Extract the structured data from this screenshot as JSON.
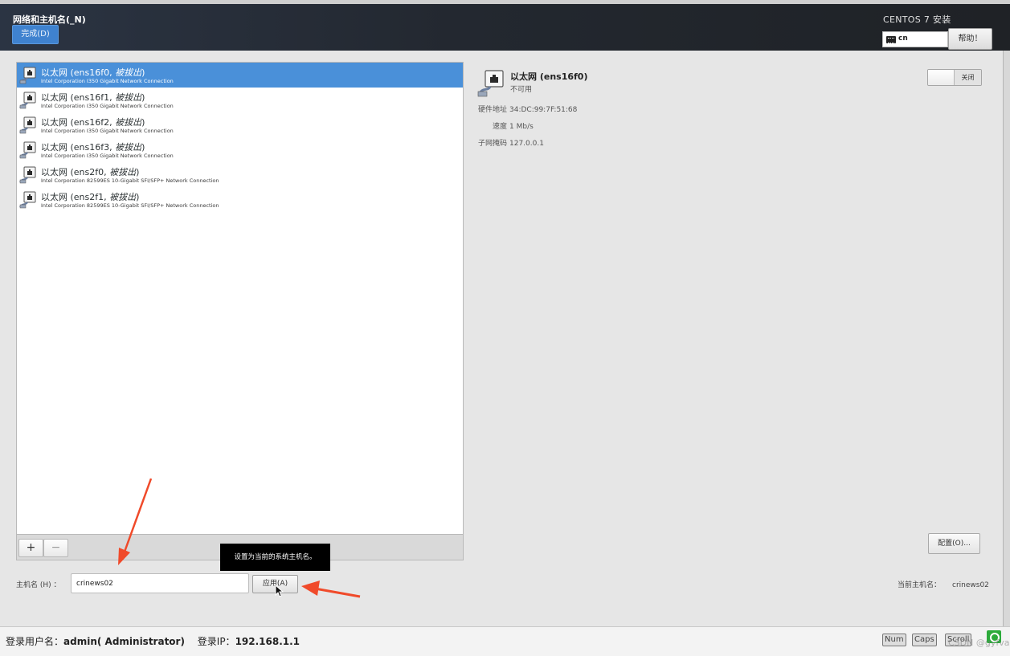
{
  "header": {
    "spoke_title": "网络和主机名(_N)",
    "done_label": "完成(D)",
    "product_title": "CENTOS 7 安装",
    "keyboard_layout": "cn",
    "help_label": "帮助！"
  },
  "devices": [
    {
      "name": "以太网 (ens16f0, ",
      "state": "被拔出",
      "close": ")",
      "description": "Intel Corporation I350 Gigabit Network Connection",
      "selected": true
    },
    {
      "name": "以太网 (ens16f1, ",
      "state": "被拔出",
      "close": ")",
      "description": "Intel Corporation I350 Gigabit Network Connection",
      "selected": false
    },
    {
      "name": "以太网 (ens16f2, ",
      "state": "被拔出",
      "close": ")",
      "description": "Intel Corporation I350 Gigabit Network Connection",
      "selected": false
    },
    {
      "name": "以太网 (ens16f3, ",
      "state": "被拔出",
      "close": ")",
      "description": "Intel Corporation I350 Gigabit Network Connection",
      "selected": false
    },
    {
      "name": "以太网 (ens2f0, ",
      "state": "被拔出",
      "close": ")",
      "description": "Intel Corporation 82599ES 10-Gigabit SFI/SFP+ Network Connection",
      "selected": false
    },
    {
      "name": "以太网 (ens2f1, ",
      "state": "被拔出",
      "close": ")",
      "description": "Intel Corporation 82599ES 10-Gigabit SFI/SFP+ Network Connection",
      "selected": false
    }
  ],
  "list_toolbar": {
    "add_label": "+",
    "remove_label": "−"
  },
  "detail": {
    "title": "以太网 (ens16f0)",
    "status": "不可用",
    "hw_label": "硬件地址",
    "hw_value": "34:DC:99:7F:51:68",
    "speed_label": "速度",
    "speed_value": "1 Mb/s",
    "mask_label": "子网掩码",
    "mask_value": "127.0.0.1",
    "toggle_label": "关闭",
    "config_label": "配置(O)..."
  },
  "hostname": {
    "label": "主机名 (H) ：",
    "value": "crinews02",
    "apply_label": "应用(A)",
    "tooltip": "设置为当前的系统主机名。",
    "current_label": "当前主机名：",
    "current_value": "crinews02"
  },
  "statusbar": {
    "user_label": "登录用户名：",
    "user_value": "admin( Administrator)",
    "ip_label": "登录IP：",
    "ip_value": "192.168.1.1",
    "num_lock": "Num",
    "caps_lock": "Caps",
    "scroll_lock": "Scroll",
    "watermark": "CSDN @gyfvar"
  },
  "colors": {
    "accent": "#4a90d9",
    "header_bg": "#232830",
    "annotation_arrow": "#f04a2a"
  }
}
